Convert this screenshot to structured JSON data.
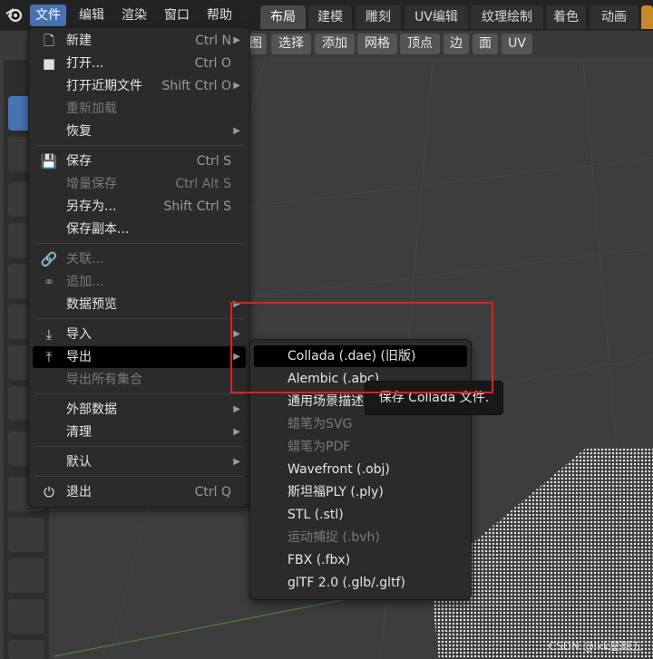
{
  "menubar": {
    "items": [
      "文件",
      "编辑",
      "渲染",
      "窗口",
      "帮助"
    ],
    "active_index": 0
  },
  "workspace_tabs": {
    "items": [
      "布局",
      "建模",
      "雕刻",
      "UV编辑",
      "纹理绘制",
      "着色",
      "动画"
    ],
    "active_index": 0
  },
  "viewport_header": {
    "buttons": [
      "图",
      "选择",
      "添加",
      "网格",
      "顶点",
      "边",
      "面",
      "UV"
    ]
  },
  "file_menu": {
    "items": [
      {
        "icon": "new-file-icon",
        "label": "新建",
        "shortcut": "Ctrl N",
        "arrow": true,
        "disabled": false
      },
      {
        "icon": "folder-icon",
        "label": "打开...",
        "shortcut": "Ctrl O",
        "arrow": false,
        "disabled": false
      },
      {
        "icon": "",
        "label": "打开近期文件",
        "shortcut": "Shift Ctrl O",
        "arrow": true,
        "disabled": false
      },
      {
        "icon": "",
        "label": "重新加载",
        "shortcut": "",
        "arrow": false,
        "disabled": true
      },
      {
        "icon": "",
        "label": "恢复",
        "shortcut": "",
        "arrow": true,
        "disabled": false
      },
      {
        "icon": "save-icon",
        "label": "保存",
        "shortcut": "Ctrl S",
        "arrow": false,
        "disabled": false
      },
      {
        "icon": "",
        "label": "增量保存",
        "shortcut": "Ctrl Alt S",
        "arrow": false,
        "disabled": true
      },
      {
        "icon": "",
        "label": "另存为...",
        "shortcut": "Shift Ctrl S",
        "arrow": false,
        "disabled": false
      },
      {
        "icon": "",
        "label": "保存副本...",
        "shortcut": "",
        "arrow": false,
        "disabled": false
      },
      {
        "icon": "link-icon",
        "label": "关联...",
        "shortcut": "",
        "arrow": false,
        "disabled": true
      },
      {
        "icon": "append-icon",
        "label": "追加...",
        "shortcut": "",
        "arrow": false,
        "disabled": true
      },
      {
        "icon": "",
        "label": "数据预览",
        "shortcut": "",
        "arrow": true,
        "disabled": false
      },
      {
        "icon": "import-icon",
        "label": "导入",
        "shortcut": "",
        "arrow": true,
        "disabled": false
      },
      {
        "icon": "export-icon",
        "label": "导出",
        "shortcut": "",
        "arrow": true,
        "disabled": false,
        "highlighted": true
      },
      {
        "icon": "",
        "label": "导出所有集合",
        "shortcut": "",
        "arrow": false,
        "disabled": true
      },
      {
        "icon": "",
        "label": "外部数据",
        "shortcut": "",
        "arrow": true,
        "disabled": false
      },
      {
        "icon": "",
        "label": "清理",
        "shortcut": "",
        "arrow": true,
        "disabled": false
      },
      {
        "icon": "",
        "label": "默认",
        "shortcut": "",
        "arrow": true,
        "disabled": false
      },
      {
        "icon": "power-icon",
        "label": "退出",
        "shortcut": "Ctrl Q",
        "arrow": false,
        "disabled": false
      }
    ]
  },
  "export_submenu": {
    "items": [
      {
        "label": "Collada (.dae) (旧版)",
        "disabled": false,
        "highlighted": true
      },
      {
        "label": "Alembic (.abc)",
        "disabled": false
      },
      {
        "label": "通用场景描述",
        "disabled": false
      },
      {
        "label": "蜡笔为SVG",
        "disabled": true
      },
      {
        "label": "蜡笔为PDF",
        "disabled": true
      },
      {
        "label": "Wavefront (.obj)",
        "disabled": false
      },
      {
        "label": "斯坦福PLY (.ply)",
        "disabled": false
      },
      {
        "label": "STL (.stl)",
        "disabled": false
      },
      {
        "label": "运动捕捉 (.bvh)",
        "disabled": true
      },
      {
        "label": "FBX (.fbx)",
        "disabled": false
      },
      {
        "label": "glTF 2.0 (.glb/.gltf)",
        "disabled": false
      }
    ]
  },
  "tooltip": {
    "text": "保存 Collada 文件."
  },
  "watermark": {
    "text": "CSDN @lkk星期五"
  },
  "colors": {
    "accent": "#4772b3",
    "annotation_box": "#e02020",
    "menu_bg": "#2b2b2b"
  }
}
